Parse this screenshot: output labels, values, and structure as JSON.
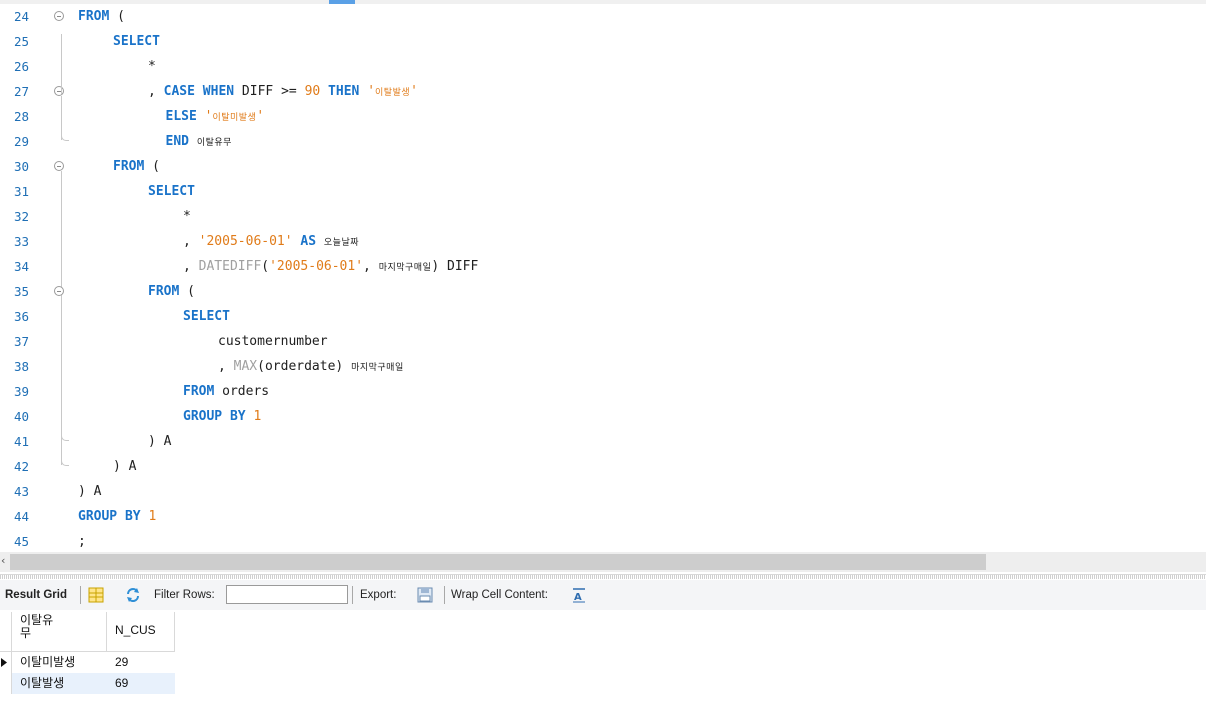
{
  "editor": {
    "lines": [
      {
        "n": "24",
        "segs": [
          [
            "kw",
            "FROM"
          ],
          [
            "t",
            " ("
          ]
        ],
        "indent": 0
      },
      {
        "n": "25",
        "segs": [
          [
            "kw",
            "SELECT"
          ]
        ],
        "indent": 1
      },
      {
        "n": "26",
        "segs": [
          [
            "t",
            "*"
          ]
        ],
        "indent": 2
      },
      {
        "n": "27",
        "segs": [
          [
            "t",
            ", "
          ],
          [
            "kw",
            "CASE WHEN"
          ],
          [
            "t",
            " DIFF >= "
          ],
          [
            "num",
            "90"
          ],
          [
            "t",
            " "
          ],
          [
            "kw",
            "THEN"
          ],
          [
            "t",
            " "
          ],
          [
            "str",
            "'"
          ],
          [
            "strkr",
            "이탈발생"
          ],
          [
            "str",
            "'"
          ]
        ],
        "indent": 2
      },
      {
        "n": "28",
        "segs": [
          [
            "kw",
            "ELSE"
          ],
          [
            "t",
            " "
          ],
          [
            "str",
            "'"
          ],
          [
            "strkr",
            "이탈미발생"
          ],
          [
            "str",
            "'"
          ]
        ],
        "indent": 2.5
      },
      {
        "n": "29",
        "segs": [
          [
            "kw",
            "END"
          ],
          [
            "t",
            " "
          ],
          [
            "kr",
            "이탈유무"
          ]
        ],
        "indent": 2.5
      },
      {
        "n": "30",
        "segs": [
          [
            "kw",
            "FROM"
          ],
          [
            "t",
            " ("
          ]
        ],
        "indent": 1
      },
      {
        "n": "31",
        "segs": [
          [
            "kw",
            "SELECT"
          ]
        ],
        "indent": 2
      },
      {
        "n": "32",
        "segs": [
          [
            "t",
            "*"
          ]
        ],
        "indent": 3
      },
      {
        "n": "33",
        "segs": [
          [
            "t",
            ", "
          ],
          [
            "str",
            "'2005-06-01'"
          ],
          [
            "t",
            " "
          ],
          [
            "kw",
            "AS"
          ],
          [
            "t",
            " "
          ],
          [
            "kr",
            "오늘날짜"
          ]
        ],
        "indent": 3
      },
      {
        "n": "34",
        "segs": [
          [
            "t",
            ", "
          ],
          [
            "fn",
            "DATEDIFF"
          ],
          [
            "t",
            "("
          ],
          [
            "str",
            "'2005-06-01'"
          ],
          [
            "t",
            ", "
          ],
          [
            "kr",
            "마지막구매일"
          ],
          [
            "t",
            ") DIFF"
          ]
        ],
        "indent": 3
      },
      {
        "n": "35",
        "segs": [
          [
            "kw",
            "FROM"
          ],
          [
            "t",
            " ("
          ]
        ],
        "indent": 2
      },
      {
        "n": "36",
        "segs": [
          [
            "kw",
            "SELECT"
          ]
        ],
        "indent": 3
      },
      {
        "n": "37",
        "segs": [
          [
            "t",
            "customernumber"
          ]
        ],
        "indent": 4
      },
      {
        "n": "38",
        "segs": [
          [
            "t",
            ", "
          ],
          [
            "fn",
            "MAX"
          ],
          [
            "t",
            "(orderdate) "
          ],
          [
            "kr",
            "마지막구매일"
          ]
        ],
        "indent": 4
      },
      {
        "n": "39",
        "segs": [
          [
            "kw",
            "FROM"
          ],
          [
            "t",
            " orders"
          ]
        ],
        "indent": 3
      },
      {
        "n": "40",
        "segs": [
          [
            "kw",
            "GROUP BY"
          ],
          [
            "t",
            " "
          ],
          [
            "num",
            "1"
          ]
        ],
        "indent": 3
      },
      {
        "n": "41",
        "segs": [
          [
            "t",
            ") A"
          ]
        ],
        "indent": 2
      },
      {
        "n": "42",
        "segs": [
          [
            "t",
            ") A"
          ]
        ],
        "indent": 1
      },
      {
        "n": "43",
        "segs": [
          [
            "t",
            ") A"
          ]
        ],
        "indent": 0
      },
      {
        "n": "44",
        "segs": [
          [
            "kw",
            "GROUP BY"
          ],
          [
            "t",
            " "
          ],
          [
            "num",
            "1"
          ]
        ],
        "indent": 0
      },
      {
        "n": "45",
        "segs": [
          [
            "t",
            ";"
          ]
        ],
        "indent": 0
      }
    ]
  },
  "result_toolbar": {
    "result_grid_label": "Result Grid",
    "filter_rows_label": "Filter Rows:",
    "filter_rows_value": "",
    "export_label": "Export:",
    "wrap_label": "Wrap Cell Content:"
  },
  "grid": {
    "columns": [
      "이탈유\n무",
      "N_CUS"
    ],
    "rows": [
      [
        "이탈미발생",
        "29"
      ],
      [
        "이탈발생",
        "69"
      ]
    ],
    "selected_row": 1
  }
}
